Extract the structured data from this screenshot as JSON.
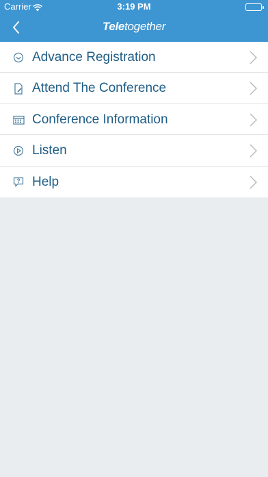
{
  "status_bar": {
    "carrier": "Carrier",
    "time": "3:19 PM",
    "wifi_icon": "wifi-icon",
    "battery_icon": "battery-icon",
    "battery_level": 1.0
  },
  "nav": {
    "back_icon": "chevron-left-icon",
    "logo_part1": "Tele",
    "logo_part2": "together"
  },
  "menu": {
    "items": [
      {
        "label": "Advance Registration",
        "icon": "registration-icon"
      },
      {
        "label": "Attend The Conference",
        "icon": "document-edit-icon"
      },
      {
        "label": "Conference Information",
        "icon": "calendar-icon"
      },
      {
        "label": "Listen",
        "icon": "play-circle-icon"
      },
      {
        "label": "Help",
        "icon": "help-bubble-icon"
      }
    ],
    "chevron_icon": "chevron-right-icon"
  },
  "colors": {
    "header": "#3d95d2",
    "label": "#1f5d86",
    "background": "#eaedf0"
  }
}
